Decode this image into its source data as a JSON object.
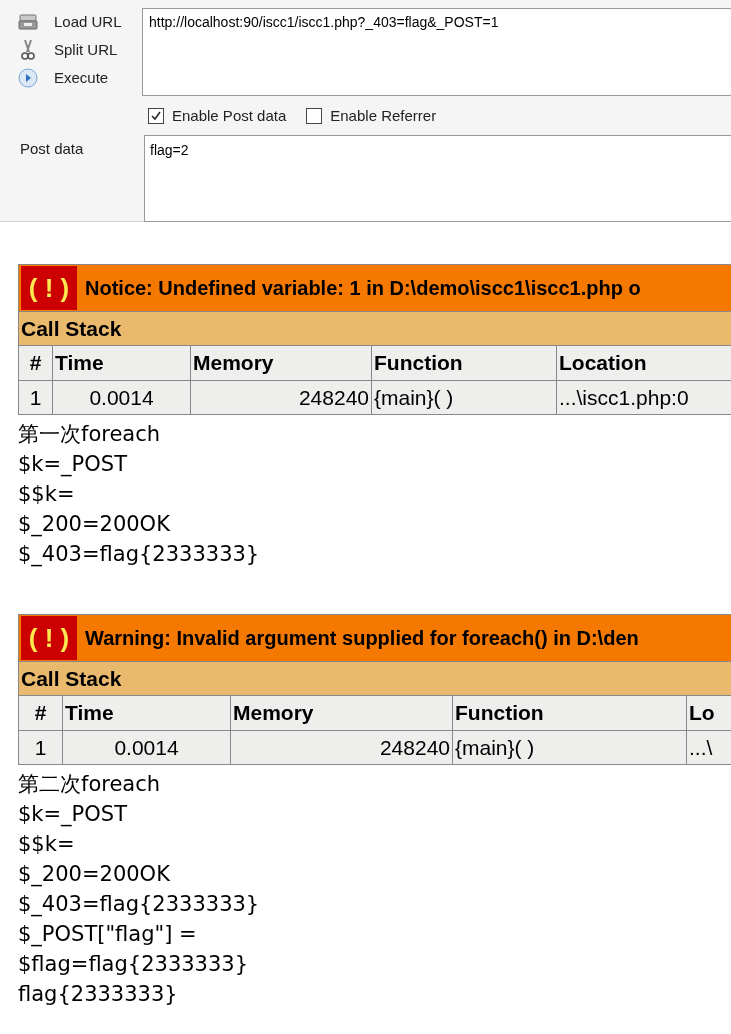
{
  "toolbar_actions": [
    {
      "kind": "load",
      "label": "Load URL"
    },
    {
      "kind": "split",
      "label": "Split URL"
    },
    {
      "kind": "execute",
      "label": "Execute"
    }
  ],
  "url_field": {
    "value": "http://localhost:90/iscc1/iscc1.php?_403=flag&_POST=1"
  },
  "options": [
    {
      "label": "Enable Post data",
      "checked": true
    },
    {
      "label": "Enable Referrer",
      "checked": false
    }
  ],
  "post_data": {
    "label": "Post data",
    "value": "flag=2"
  },
  "output": [
    {
      "kind": "error",
      "icon": "( ! )",
      "message": "Notice: Undefined variable: 1 in D:\\demo\\iscc1\\iscc1.php o",
      "call_stack_title": "Call Stack",
      "columns": [
        "#",
        "Time",
        "Memory",
        "Function",
        "Location"
      ],
      "rows": [
        [
          "1",
          "0.0014",
          "248240",
          "{main}( )",
          "...\\iscc1.php:0"
        ]
      ]
    },
    {
      "kind": "text",
      "lines": [
        "第一次foreach",
        "$k=_POST",
        "$$k=",
        "$_200=200OK",
        "$_403=flag{2333333}"
      ]
    },
    {
      "kind": "error",
      "icon": "( ! )",
      "message": "Warning: Invalid argument supplied for foreach() in D:\\den",
      "call_stack_title": "Call Stack",
      "columns": [
        "#",
        "Time",
        "Memory",
        "Function",
        "Lo"
      ],
      "rows": [
        [
          "1",
          "0.0014",
          "248240",
          "{main}( )",
          "...\\"
        ]
      ]
    },
    {
      "kind": "text",
      "lines": [
        "第二次foreach",
        "$k=_POST",
        "$$k=",
        "$_200=200OK",
        "$_403=flag{2333333}",
        "$_POST[\"flag\"] =",
        "$flag=flag{2333333}",
        "flag{2333333}"
      ]
    }
  ]
}
